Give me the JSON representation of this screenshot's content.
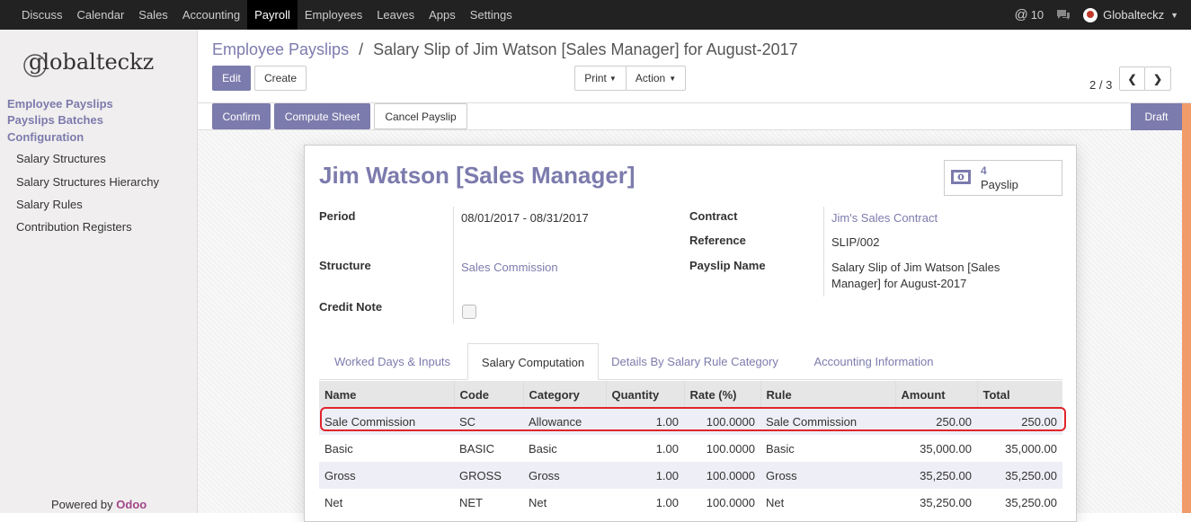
{
  "topbar": {
    "menu": [
      "Discuss",
      "Calendar",
      "Sales",
      "Accounting",
      "Payroll",
      "Employees",
      "Leaves",
      "Apps",
      "Settings"
    ],
    "active": "Payroll",
    "notifications": "10",
    "user": "Globalteckz"
  },
  "sidebar": {
    "logo": "globalteckz",
    "headers": [
      "Employee Payslips",
      "Payslips Batches",
      "Configuration"
    ],
    "items": [
      "Salary Structures",
      "Salary Structures Hierarchy",
      "Salary Rules",
      "Contribution Registers"
    ],
    "powered_by": "Powered by",
    "powered_brand": "Odoo"
  },
  "breadcrumb": {
    "parent": "Employee Payslips",
    "separator": "/",
    "current": "Salary Slip of Jim Watson [Sales Manager] for August-2017"
  },
  "buttons": {
    "edit": "Edit",
    "create": "Create",
    "print": "Print",
    "action": "Action",
    "confirm": "Confirm",
    "compute_sheet": "Compute Sheet",
    "cancel_payslip": "Cancel Payslip"
  },
  "pager": {
    "text": "2 / 3"
  },
  "status": "Draft",
  "form": {
    "title": "Jim Watson [Sales Manager]",
    "smart_count": "4",
    "smart_label": "Payslip",
    "period_label": "Period",
    "period_value": "08/01/2017 - 08/31/2017",
    "structure_label": "Structure",
    "structure_value": "Sales Commission",
    "credit_note_label": "Credit Note",
    "contract_label": "Contract",
    "contract_value": "Jim's Sales Contract",
    "reference_label": "Reference",
    "reference_value": "SLIP/002",
    "payslip_name_label": "Payslip Name",
    "payslip_name_line1": "Salary Slip of Jim Watson [Sales",
    "payslip_name_line2": "Manager] for August-2017"
  },
  "tabs": [
    "Worked Days & Inputs",
    "Salary Computation",
    "Details By Salary Rule Category",
    "Accounting Information"
  ],
  "active_tab": "Salary Computation",
  "table": {
    "headers": [
      "Name",
      "Code",
      "Category",
      "Quantity",
      "Rate (%)",
      "Rule",
      "Amount",
      "Total"
    ],
    "rows": [
      [
        "Sale Commission",
        "SC",
        "Allowance",
        "1.00",
        "100.0000",
        "Sale Commission",
        "250.00",
        "250.00"
      ],
      [
        "Basic",
        "BASIC",
        "Basic",
        "1.00",
        "100.0000",
        "Basic",
        "35,000.00",
        "35,000.00"
      ],
      [
        "Gross",
        "GROSS",
        "Gross",
        "1.00",
        "100.0000",
        "Gross",
        "35,250.00",
        "35,250.00"
      ],
      [
        "Net",
        "NET",
        "Net",
        "1.00",
        "100.0000",
        "Net",
        "35,250.00",
        "35,250.00"
      ]
    ]
  },
  "colors": {
    "accent": "#7c7bad",
    "highlight": "#e0242b",
    "topbar": "#222222"
  }
}
